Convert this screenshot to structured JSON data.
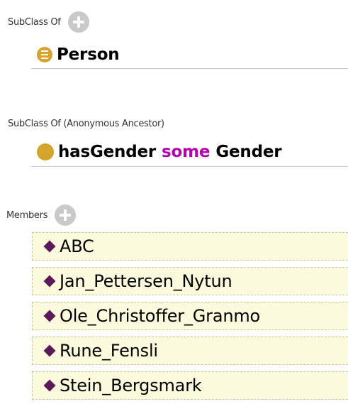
{
  "subclass_of": {
    "label": "SubClass Of",
    "items": [
      {
        "name": "Person"
      }
    ]
  },
  "anonymous_ancestor": {
    "label": "SubClass Of (Anonymous Ancestor)",
    "items": [
      {
        "property": "hasGender",
        "keyword": "some",
        "filler": "Gender"
      }
    ]
  },
  "members": {
    "label": "Members",
    "items": [
      {
        "name": "ABC"
      },
      {
        "name": "Jan_Pettersen_Nytun"
      },
      {
        "name": "Ole_Christoffer_Granmo"
      },
      {
        "name": "Rune_Fensli"
      },
      {
        "name": "Stein_Bergsmark"
      }
    ]
  },
  "colors": {
    "class_icon": "#d4a42c",
    "individual_icon": "#5a1a5a",
    "keyword": "#b000b0",
    "member_bg": "#fbfadd"
  }
}
